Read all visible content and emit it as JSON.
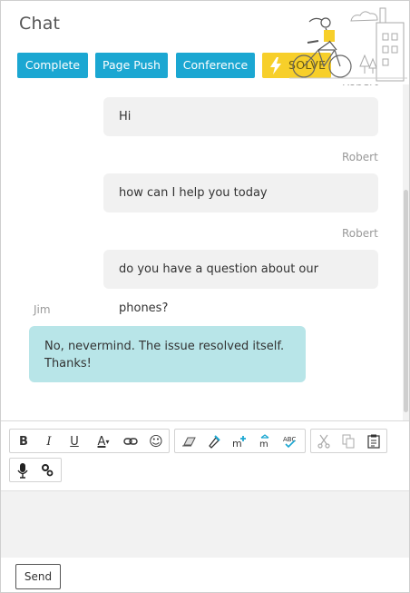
{
  "header": {
    "title": "Chat",
    "buttons": {
      "complete": "Complete",
      "page_push": "Page Push",
      "conference": "Conference",
      "solve": "SOLVE"
    }
  },
  "messages": [
    {
      "sender": "Robert",
      "text": "Hi"
    },
    {
      "sender": "Robert",
      "text": "how can I help you today"
    },
    {
      "sender": "Robert",
      "text": "do you have a question about our phones?"
    },
    {
      "sender": "Jim",
      "text": "No, nevermind. The issue resolved itself. Thanks!"
    }
  ],
  "toolbar": {
    "groups": [
      [
        "bold-icon",
        "italic-icon",
        "underline-icon",
        "text-color-icon",
        "link-icon",
        "emoji-icon"
      ],
      [
        "eraser-icon",
        "format-brush-icon",
        "insert-template-icon",
        "move-icon",
        "spellcheck-icon"
      ],
      [
        "cut-icon",
        "copy-icon",
        "paste-icon"
      ],
      [
        "microphone-icon",
        "settings-icon"
      ]
    ]
  },
  "footer": {
    "send_label": "Send"
  },
  "colors": {
    "primary_button": "#1ba7d2",
    "solve_button": "#f7cf2a",
    "agent_bubble": "#f1f1f1",
    "visitor_bubble": "#b8e5e8"
  }
}
